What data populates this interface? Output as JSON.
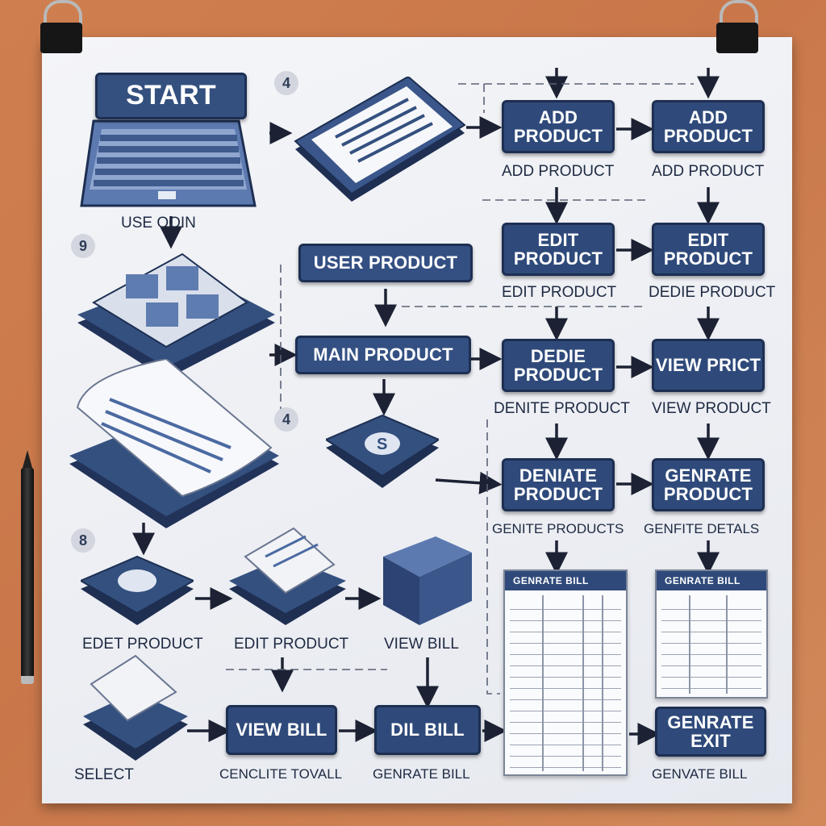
{
  "colors": {
    "box_fill": "#2f4a7a",
    "paper": "#eef0f4",
    "background": "#cf7f4f",
    "text": "#1e2a42"
  },
  "boxes": {
    "start": "START",
    "add_product_1": "ADD PRODUCT",
    "add_product_2": "ADD PRODUCT",
    "user_product": "USER PRODUCT",
    "edit_product_1": "EDIT PRODUCT",
    "edit_product_2": "EDIT PRODUCT",
    "main_product": "MAIN PRODUCT",
    "dedie_product": "DEDIE PRODUCT",
    "view_prict": "VIEW PRICT",
    "deniate_product": "DENIATE PRODUCT",
    "genrate_product": "GENRATE PRODUCT",
    "view_bill": "VIEW BILL",
    "dil_bill": "DIL BILL",
    "genrate_exit": "GENRATE EXIT"
  },
  "labels": {
    "use_login": "USE OOIN",
    "add_product_a": "ADD PRODUCT",
    "add_product_b": "ADD PRODUCT",
    "edit_product_a": "EDIT PRODUCT",
    "delete_product_b": "DEDIE PRODUCT",
    "denite_product": "DENITE PRODUCT",
    "view_product": "VIEW PRODUCT",
    "genite_products": "GENITE PRODUCTS",
    "genfite_details": "GENFITE DETALS",
    "edet_product": "EDET PRODUCT",
    "edit_product_c": "EDIT PRODUCT",
    "view_bill": "VIEW BILL",
    "select": "SELECT",
    "cenclite_total": "CENCLITE TOVALL",
    "genrate_bill": "GENRATE BILL",
    "genvate_bill": "GENVATE BILL"
  },
  "tables": {
    "left_header": "GENRATE BILL",
    "right_header": "GENRATE BILL"
  },
  "step_numbers": [
    "4",
    "9",
    "4",
    "8"
  ],
  "icons": [
    "laptop-icon",
    "document-icon",
    "product-tray-icon",
    "printed-bill-icon",
    "dollar-stack-icon",
    "box-icon",
    "report-table-icon"
  ]
}
